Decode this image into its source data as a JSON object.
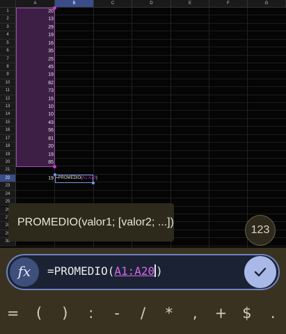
{
  "spreadsheet": {
    "columns": [
      "A",
      "B",
      "C",
      "D",
      "E",
      "F",
      "G"
    ],
    "selected_column": "B",
    "rows": [
      1,
      2,
      3,
      4,
      5,
      6,
      7,
      8,
      9,
      10,
      11,
      12,
      13,
      14,
      15,
      16,
      17,
      18,
      19,
      20,
      21,
      22,
      23,
      24,
      25,
      26,
      27,
      28,
      29,
      30
    ],
    "selected_row": 22,
    "column_a_values": [
      "20",
      "13",
      "29",
      "19",
      "16",
      "35",
      "25",
      "45",
      "19",
      "82",
      "73",
      "15",
      "10",
      "10",
      "43",
      "56",
      "81",
      "20",
      "19",
      "85"
    ],
    "a22_value": "19",
    "active_cell_prefix": "=PROMEDIO(",
    "active_cell_ref": "A1:A20",
    "active_cell_suffix": ")"
  },
  "tooltip": {
    "text": "PROMEDIO(valor1; [valor2; ...])"
  },
  "mode_button": {
    "label": "123"
  },
  "formula_bar": {
    "fx_label": "fx",
    "prefix": "=PROMEDIO(",
    "ref": "A1:A20",
    "suffix": ")"
  },
  "keyboard": {
    "keys": [
      "=",
      "(",
      ")",
      ":",
      "-",
      "/",
      "*",
      ",",
      "+",
      "$",
      "."
    ]
  },
  "colors": {
    "range_fill": "#3d1f45",
    "range_border": "#a24bb5",
    "reference_text": "#d56ae8",
    "formula_bar_border": "#6f83c4",
    "confirm_button": "#a8b9e8",
    "panel_background": "#3a3220"
  }
}
